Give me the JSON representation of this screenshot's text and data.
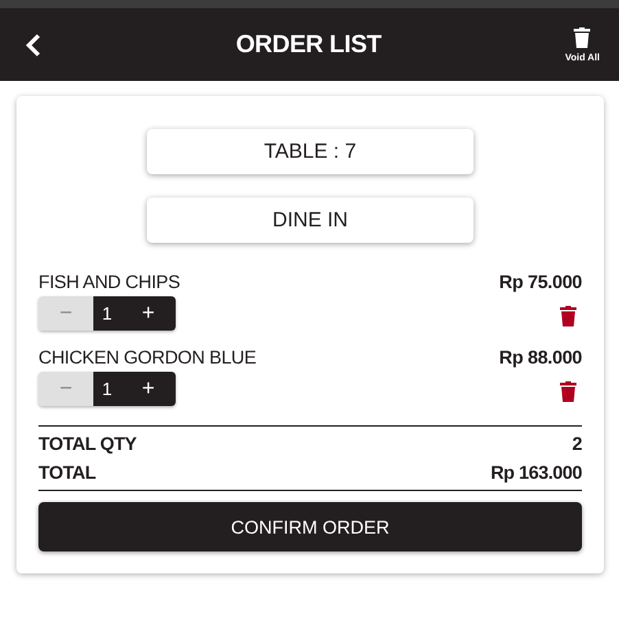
{
  "header": {
    "title": "ORDER LIST",
    "void_label": "Void All"
  },
  "table_label": "TABLE : 7",
  "service_label": "DINE IN",
  "items": [
    {
      "name": "FISH AND CHIPS",
      "price": "Rp 75.000",
      "minus": "−",
      "qty": "1",
      "plus": "+",
      "minus_disabled": true
    },
    {
      "name": "CHICKEN GORDON BLUE",
      "price": "Rp 88.000",
      "minus": "−",
      "qty": "1",
      "plus": "+",
      "minus_disabled": true
    }
  ],
  "totals": [
    {
      "label": "TOTAL QTY",
      "value": "2"
    },
    {
      "label": "TOTAL",
      "value": "Rp 163.000"
    }
  ],
  "confirm_label": "CONFIRM ORDER"
}
